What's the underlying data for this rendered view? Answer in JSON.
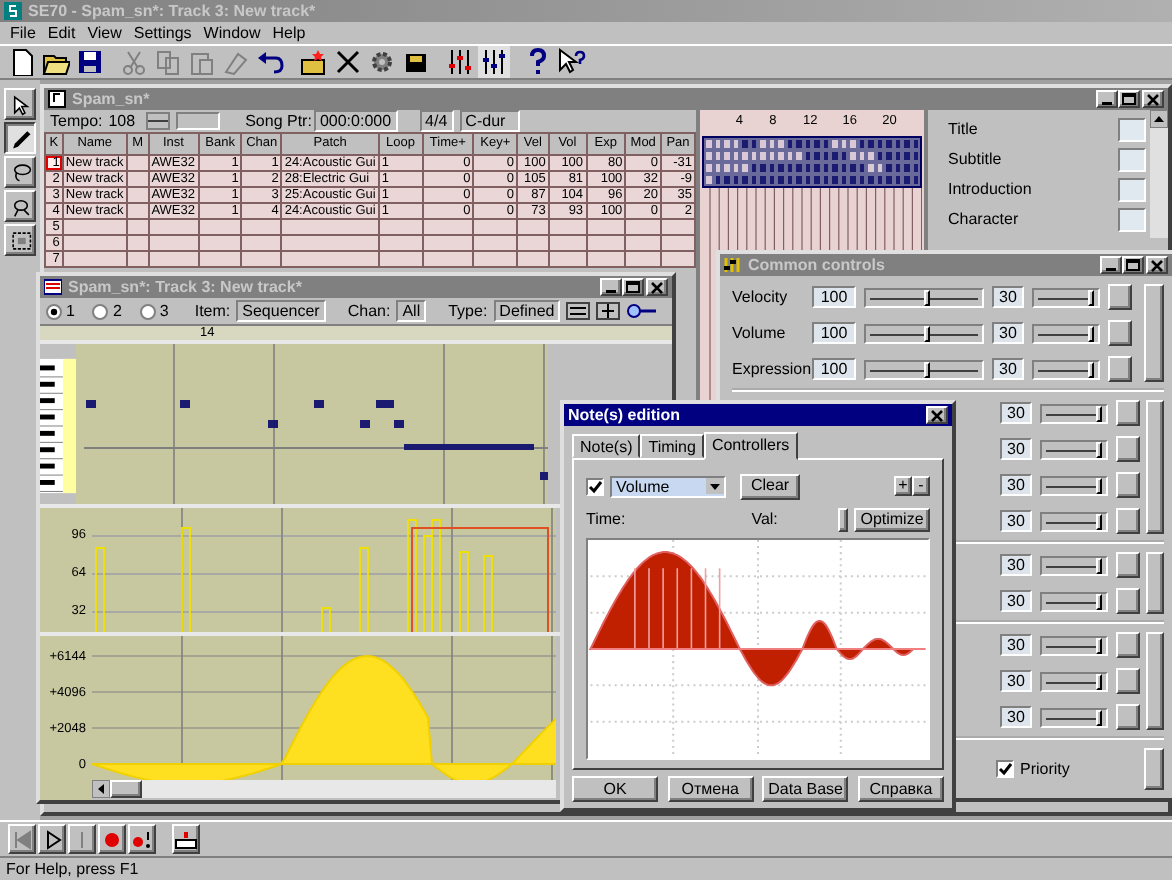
{
  "window": {
    "title": "SE70 - Spam_sn*: Track 3: New track*"
  },
  "menu": [
    "File",
    "Edit",
    "View",
    "Settings",
    "Window",
    "Help"
  ],
  "tools": [
    {
      "selected": false
    },
    {
      "selected": true
    },
    {
      "selected": false
    },
    {
      "selected": false
    },
    {
      "selected": false
    }
  ],
  "song_window": {
    "title": "Spam_sn*",
    "tempo_label": "Tempo:",
    "tempo": "108",
    "song_ptr_label": "Song Ptr:",
    "song_ptr": "000:0:000",
    "meter": "4/4",
    "key": "C-dur",
    "columns": [
      "K",
      "Name",
      "M",
      "Inst",
      "Bank",
      "Chan",
      "Patch",
      "Loop",
      "Time+",
      "Key+",
      "Vel",
      "Vol",
      "Exp",
      "Mod",
      "Pan"
    ],
    "rows": [
      {
        "focused": true,
        "cells": [
          "1",
          "New track",
          "",
          "AWE32",
          "1",
          "1",
          "24:Acoustic Gui",
          "1",
          "0",
          "0",
          "100",
          "100",
          "80",
          "0",
          "-31"
        ]
      },
      {
        "focused": false,
        "cells": [
          "2",
          "New track",
          "",
          "AWE32",
          "1",
          "2",
          "28:Electric Gui",
          "1",
          "0",
          "0",
          "105",
          "81",
          "100",
          "32",
          "-9"
        ]
      },
      {
        "focused": false,
        "cells": [
          "3",
          "New track",
          "",
          "AWE32",
          "1",
          "3",
          "25:Acoustic Gui",
          "1",
          "0",
          "0",
          "87",
          "104",
          "96",
          "20",
          "35"
        ]
      },
      {
        "focused": false,
        "cells": [
          "4",
          "New track",
          "",
          "AWE32",
          "1",
          "4",
          "24:Acoustic Gui",
          "1",
          "0",
          "0",
          "73",
          "93",
          "100",
          "0",
          "2"
        ]
      },
      {
        "focused": false,
        "cells": [
          "5",
          "",
          "",
          "",
          "",
          "",
          "",
          "",
          "",
          "",
          "",
          "",
          "",
          "",
          ""
        ]
      },
      {
        "focused": false,
        "cells": [
          "6",
          "",
          "",
          "",
          "",
          "",
          "",
          "",
          "",
          "",
          "",
          "",
          "",
          "",
          ""
        ]
      },
      {
        "focused": false,
        "cells": [
          "7",
          "",
          "",
          "",
          "",
          "",
          "",
          "",
          "",
          "",
          "",
          "",
          "",
          "",
          ""
        ]
      }
    ],
    "grid": {
      "ticks": [
        "4",
        "8",
        "12",
        "16",
        "20"
      ],
      "rows": [
        [
          false,
          false,
          false,
          false,
          true,
          true,
          false,
          false,
          false,
          true,
          true,
          true,
          true,
          true,
          false,
          false,
          false,
          true,
          true,
          true,
          true,
          true,
          true,
          true
        ],
        [
          false,
          false,
          false,
          false,
          false,
          false,
          false,
          false,
          false,
          false,
          false,
          true,
          true,
          true,
          true,
          true,
          false,
          false,
          false,
          true,
          true,
          true,
          true,
          true
        ],
        [
          false,
          false,
          false,
          false,
          false,
          true,
          true,
          true,
          true,
          true,
          true,
          true,
          true,
          true,
          true,
          true,
          true,
          true,
          false,
          false,
          true,
          true,
          true,
          true
        ],
        [
          false,
          true,
          true,
          true,
          true,
          true,
          true,
          true,
          true,
          true,
          true,
          true,
          true,
          true,
          true,
          true,
          true,
          true,
          true,
          true,
          true,
          true,
          true,
          true
        ]
      ]
    },
    "fields": [
      "Title",
      "Subtitle",
      "Introduction",
      "Character"
    ]
  },
  "track_window": {
    "title": "Spam_sn*: Track 3: New track*",
    "options": [
      {
        "label": "1",
        "selected": true
      },
      {
        "label": "2",
        "selected": false
      },
      {
        "label": "3",
        "selected": false
      }
    ],
    "item_label": "Item:",
    "item": "Sequencer",
    "chan_label": "Chan:",
    "chan": "All",
    "type_label": "Type:",
    "type": "Defined",
    "ruler": "14",
    "velocity_ticks": [
      "96",
      "64",
      "32"
    ],
    "controller_ticks": [
      "+6144",
      "+4096",
      "+2048",
      "0"
    ]
  },
  "common_controls": {
    "title": "Common controls",
    "groups": [
      [
        {
          "label": "Velocity",
          "value": "100",
          "level": 0.55,
          "range": {
            "value": "30",
            "level": 0.92
          }
        },
        {
          "label": "Volume",
          "value": "100",
          "level": 0.55,
          "range": {
            "value": "30",
            "level": 0.92
          }
        },
        {
          "label": "Expression",
          "value": "100",
          "level": 0.55,
          "range": {
            "value": "30",
            "level": 0.92
          }
        }
      ],
      [
        {
          "range": {
            "value": "30",
            "level": 0.92
          }
        },
        {
          "range": {
            "value": "30",
            "level": 0.92
          }
        },
        {
          "range": {
            "value": "30",
            "level": 0.92
          }
        },
        {
          "range": {
            "value": "30",
            "level": 0.92
          }
        }
      ],
      [
        {
          "range": {
            "value": "30",
            "level": 0.92
          }
        },
        {
          "range": {
            "value": "30",
            "level": 0.92
          }
        }
      ],
      [
        {
          "range": {
            "value": "30",
            "level": 0.92
          }
        },
        {
          "range": {
            "value": "30",
            "level": 0.92
          }
        },
        {
          "range": {
            "value": "30",
            "level": 0.92
          }
        }
      ]
    ],
    "priority": {
      "label": "Priority",
      "checked": true
    }
  },
  "dialog": {
    "title": "Note(s) edition",
    "tabs": [
      {
        "label": "Note(s)",
        "selected": false
      },
      {
        "label": "Timing",
        "selected": false
      },
      {
        "label": "Controllers",
        "selected": true
      }
    ],
    "enabled": true,
    "controller": "Volume",
    "clear": "Clear",
    "plus": "+",
    "minus": "-",
    "time_label": "Time:",
    "val_label": "Val:",
    "optimize": "Optimize",
    "buttons": [
      "OK",
      "Отмена",
      "Data Base",
      "Справка"
    ]
  },
  "status_bar": "For Help, press F1"
}
